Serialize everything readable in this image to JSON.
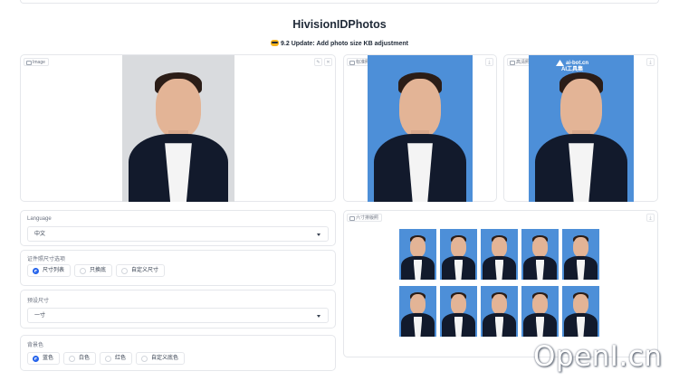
{
  "header": {
    "title": "HivisionIDPhotos",
    "subtitle": "9.2 Update: Add photo size KB adjustment"
  },
  "input_image": {
    "label": "Image",
    "edit_icon": "pencil-icon",
    "close_icon": "close-icon",
    "background_color": "#d9dbde"
  },
  "outputs": {
    "standard": {
      "label": "标准照",
      "download_icon": "download-icon"
    },
    "hd": {
      "label": "高清照",
      "download_icon": "download-icon",
      "watermark_line1": "ai-bot.cn",
      "watermark_line2": "AI工具集"
    },
    "layout": {
      "label": "六寸排版照",
      "download_icon": "download-icon"
    }
  },
  "colors": {
    "id_blue": "#4d8fd8",
    "radio_accent": "#2563eb",
    "suit": "#121a2c"
  },
  "form": {
    "language": {
      "label": "Language",
      "value": "中文"
    },
    "size_mode": {
      "label": "证件照尺寸选项",
      "options": [
        "尺寸列表",
        "只换底",
        "自定义尺寸"
      ],
      "selected": "尺寸列表"
    },
    "preset_size": {
      "label": "预设尺寸",
      "value": "一寸"
    },
    "background": {
      "label": "背景色",
      "options": [
        "蓝色",
        "白色",
        "红色",
        "自定义底色"
      ],
      "selected": "蓝色"
    }
  },
  "watermark": "OpenI.cn"
}
